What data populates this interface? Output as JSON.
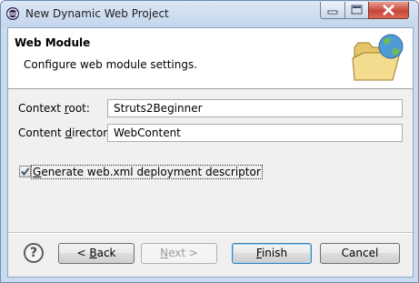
{
  "window": {
    "title": "New Dynamic Web Project"
  },
  "banner": {
    "title": "Web Module",
    "description": "Configure web module settings.",
    "icon": "folder-globe-icon"
  },
  "form": {
    "context_root": {
      "label_before": "Context ",
      "label_mnemonic": "r",
      "label_after": "oot:",
      "value": "Struts2Beginner"
    },
    "content_directory": {
      "label_before": "Content ",
      "label_mnemonic": "d",
      "label_after": "irectory:",
      "value": "WebContent"
    },
    "generate_descriptor": {
      "label_mnemonic": "G",
      "label_after": "enerate web.xml deployment descriptor",
      "checked": true
    }
  },
  "buttons": {
    "help_glyph": "?",
    "back": {
      "prefix": "< ",
      "mnemonic": "B",
      "rest": "ack"
    },
    "next": {
      "mnemonic": "N",
      "rest": "ext >"
    },
    "finish": {
      "mnemonic": "F",
      "rest": "inish"
    },
    "cancel": "Cancel"
  }
}
